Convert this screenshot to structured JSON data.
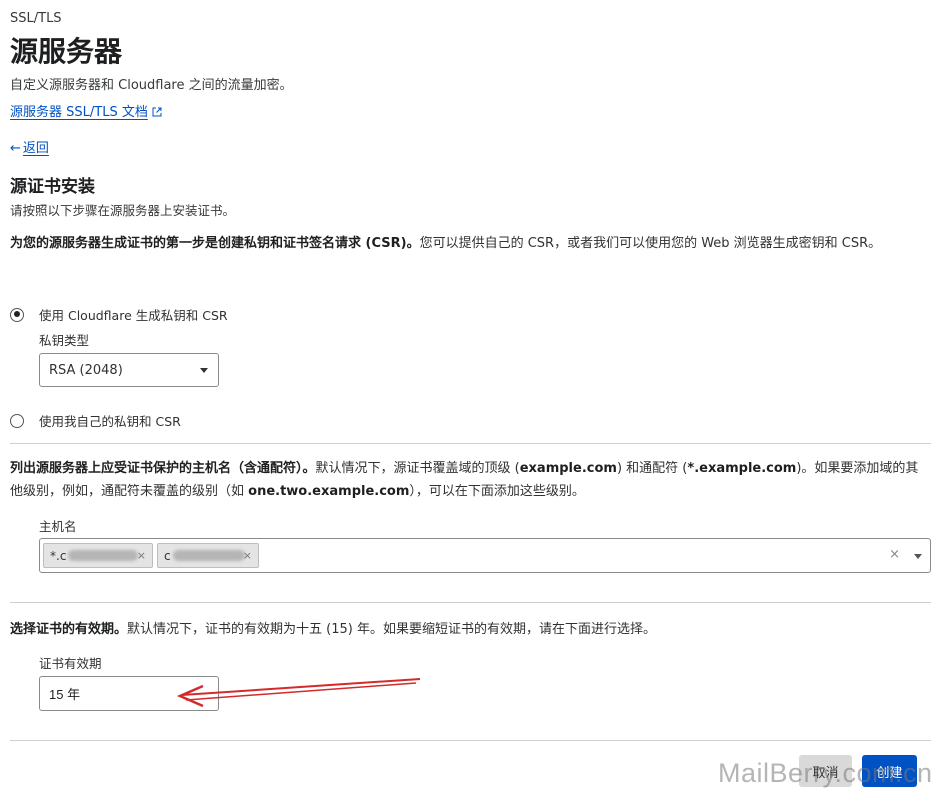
{
  "header": {
    "eyebrow": "SSL/TLS",
    "title": "源服务器",
    "subtitle": "自定义源服务器和 Cloudflare 之间的流量加密。",
    "doc_link": "源服务器 SSL/TLS 文档"
  },
  "nav": {
    "back_arrow": "←",
    "back_label": "返回"
  },
  "section": {
    "title": "源证书安装",
    "desc": "请按照以下步骤在源服务器上安装证书。"
  },
  "step1": {
    "bold": "为您的源服务器生成证书的第一步是创建私钥和证书签名请求 (CSR)。",
    "text": "您可以提供自己的 CSR，或者我们可以使用您的 Web 浏览器生成密钥和 CSR。",
    "option_generate": "使用 Cloudflare 生成私钥和 CSR",
    "key_type_label": "私钥类型",
    "key_type_value": "RSA (2048)",
    "option_own": "使用我自己的私钥和 CSR"
  },
  "step2": {
    "bold": "列出源服务器上应受证书保护的主机名（含通配符）。",
    "text_a": "默认情况下，源证书覆盖域的顶级 (",
    "ex1": "example.com",
    "text_b": ") 和通配符 (",
    "ex2": "*.example.com",
    "text_c": ")。如果要添加域的其他级别，例如，通配符未覆盖的级别（如 ",
    "ex3": "one.two.example.com",
    "text_d": "），可以在下面添加这些级别。",
    "hostname_label": "主机名",
    "chip1_prefix": "*.c",
    "chip2_prefix": "c",
    "chip_remove": "×",
    "clear_all": "×"
  },
  "step3": {
    "bold": "选择证书的有效期。",
    "text": "默认情况下，证书的有效期为十五 (15) 年。如果要缩短证书的有效期，请在下面进行选择。",
    "validity_label": "证书有效期",
    "validity_value": "15 年"
  },
  "actions": {
    "cancel": "取消",
    "create": "创建"
  },
  "watermark": "MailBerry.com.cn",
  "colors": {
    "link": "#0051c3",
    "primary_button": "#0051c3",
    "annotation_arrow": "#d42a2a"
  }
}
